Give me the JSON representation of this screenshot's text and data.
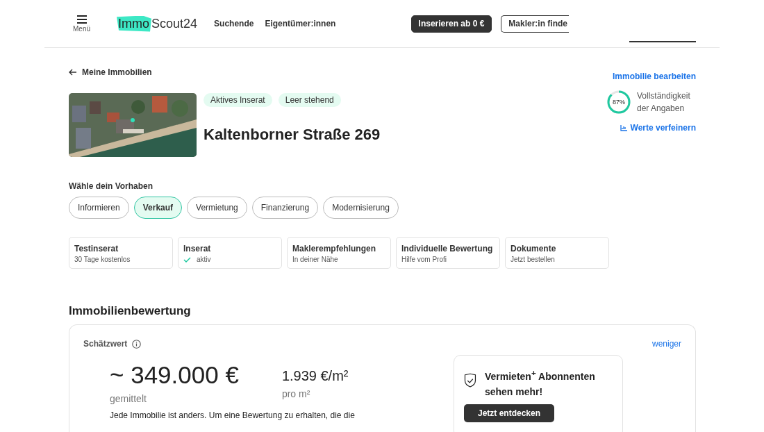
{
  "header": {
    "menu_label": "Menü",
    "logo": {
      "part_1": "Immo",
      "part_2": "Scout24"
    },
    "nav": [
      "Suchende",
      "Eigentümer:innen"
    ],
    "buttons": [
      {
        "label": "Inserieren ab 0 €",
        "kind": "primary"
      },
      {
        "label": "Makler:in finde",
        "kind": "outline"
      }
    ]
  },
  "back_link": "Meine Immobilien",
  "edit_link": "Immobilie bearbeiten",
  "property": {
    "tags": [
      "Aktives Inserat",
      "Leer stehend"
    ],
    "address": "Kaltenborner Straße 269"
  },
  "completeness": {
    "level": 0.87,
    "reading": "87%",
    "label": "Vollständigkeit der Angaben",
    "refine_link": "Werte verfeinern"
  },
  "plan": {
    "title": "Wähle dein Vorhaben",
    "options": [
      {
        "label": "Informieren",
        "selected": false
      },
      {
        "label": "Verkauf",
        "selected": true
      },
      {
        "label": "Vermietung",
        "selected": false
      },
      {
        "label": "Finanzierung",
        "selected": false
      },
      {
        "label": "Modernisierung",
        "selected": false
      }
    ]
  },
  "cards": [
    {
      "title": "Testinserat",
      "subtitle": "30 Tage kostenlos",
      "checked": false
    },
    {
      "title": "Inserat",
      "subtitle": "aktiv",
      "checked": true
    },
    {
      "title": "Maklerempfehlungen",
      "subtitle": "In deiner Nähe",
      "checked": false
    },
    {
      "title": "Individuelle Bewertung",
      "subtitle": "Hilfe vom Profi",
      "checked": false
    },
    {
      "title": "Dokumente",
      "subtitle": "Jetzt bestellen",
      "checked": false
    }
  ],
  "valuation": {
    "heading": "Immobilienbewertung",
    "label": "Schätzwert",
    "toggle": "weniger",
    "price": "~ 349.000 €",
    "price_caption": "gemittelt",
    "per_sqm": "1.939 €/m²",
    "per_sqm_caption": "pro m²",
    "text": "Jede Immobilie ist anders. Um eine Bewertung zu erhalten, die die",
    "promo": {
      "text": "Vermieten$^{+}$ Abonnenten sehen mehr!",
      "button": "Jetzt entdecken"
    }
  }
}
